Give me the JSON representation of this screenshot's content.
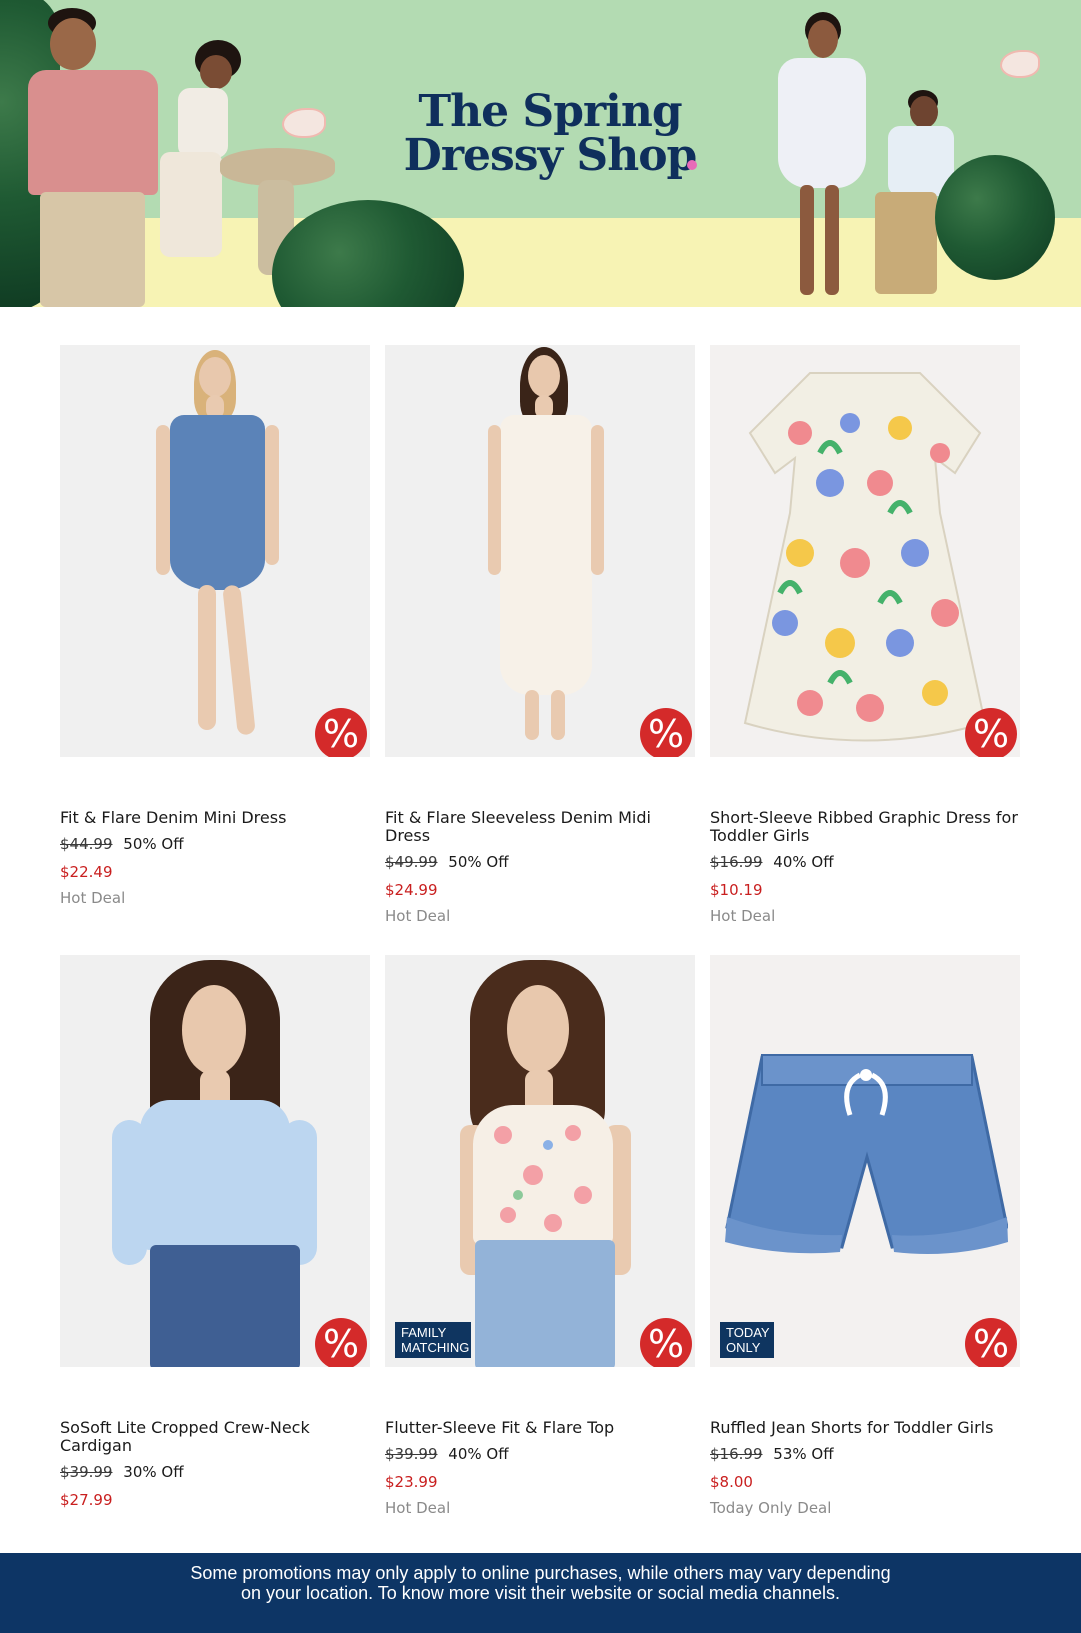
{
  "hero": {
    "title_line1": "The Spring",
    "title_line2": "Dressy Shop",
    "colors": {
      "sky": "#b3dbb2",
      "ground": "#f7f3b4",
      "title": "#0f2f5c"
    }
  },
  "products": [
    {
      "name": "Fit & Flare Denim Mini Dress",
      "original_price": "$44.99",
      "discount": "50% Off",
      "sale_price": "$22.49",
      "deal_label": "Hot Deal",
      "badge_icon": "percent-icon",
      "tag": ""
    },
    {
      "name": "Fit & Flare Sleeveless Denim Midi Dress",
      "original_price": "$49.99",
      "discount": "50% Off",
      "sale_price": "$24.99",
      "deal_label": "Hot Deal",
      "badge_icon": "percent-icon",
      "tag": ""
    },
    {
      "name": "Short-Sleeve Ribbed Graphic Dress for Toddler Girls",
      "original_price": "$16.99",
      "discount": "40% Off",
      "sale_price": "$10.19",
      "deal_label": "Hot Deal",
      "badge_icon": "percent-icon",
      "tag": ""
    },
    {
      "name": "SoSoft Lite Cropped Crew-Neck Cardigan",
      "original_price": "$39.99",
      "discount": "30% Off",
      "sale_price": "$27.99",
      "deal_label": "",
      "badge_icon": "percent-icon",
      "tag": ""
    },
    {
      "name": "Flutter-Sleeve Fit & Flare Top",
      "original_price": "$39.99",
      "discount": "40% Off",
      "sale_price": "$23.99",
      "deal_label": "Hot Deal",
      "badge_icon": "percent-icon",
      "tag": "FAMILY MATCHING"
    },
    {
      "name": "Ruffled Jean Shorts for Toddler Girls",
      "original_price": "$16.99",
      "discount": "53% Off",
      "sale_price": "$8.00",
      "deal_label": "Today Only Deal",
      "badge_icon": "percent-icon",
      "tag": "TODAY ONLY"
    }
  ],
  "badge_symbol": "%",
  "colors": {
    "sale": "#c91f1f",
    "badge": "#d42a2a",
    "tag_bg": "#0f3560",
    "footer_bg": "#0d3565"
  },
  "footer": {
    "text": "Some promotions may only apply to online purchases, while others may vary depending on your location. To know more visit their website or social media channels."
  }
}
